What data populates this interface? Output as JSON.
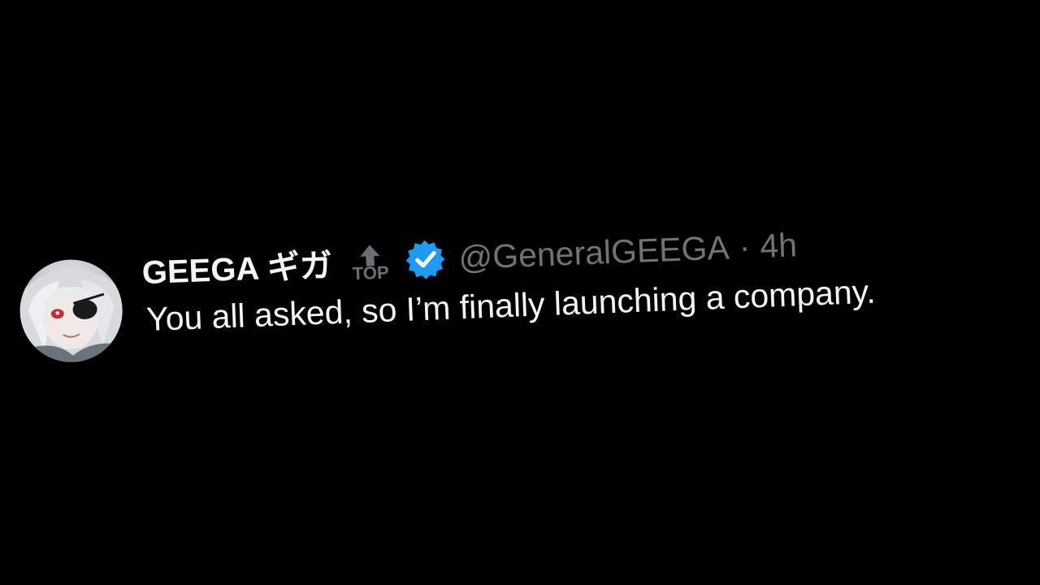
{
  "tweet": {
    "display_name": "GEEGA ギガ",
    "badge_label": "TOP",
    "handle": "@GeneralGEEGA",
    "separator": "·",
    "time": "4h",
    "text": "You all asked, so I’m finally launching a company."
  },
  "icons": {
    "avatar": "anime-character-avatar",
    "top_badge": "top-arrow-icon",
    "verified": "verified-badge-icon"
  },
  "colors": {
    "background": "#000000",
    "primary_text": "#f4f4f4",
    "secondary_text": "#6f7377",
    "verified_blue": "#1d9bf0"
  }
}
